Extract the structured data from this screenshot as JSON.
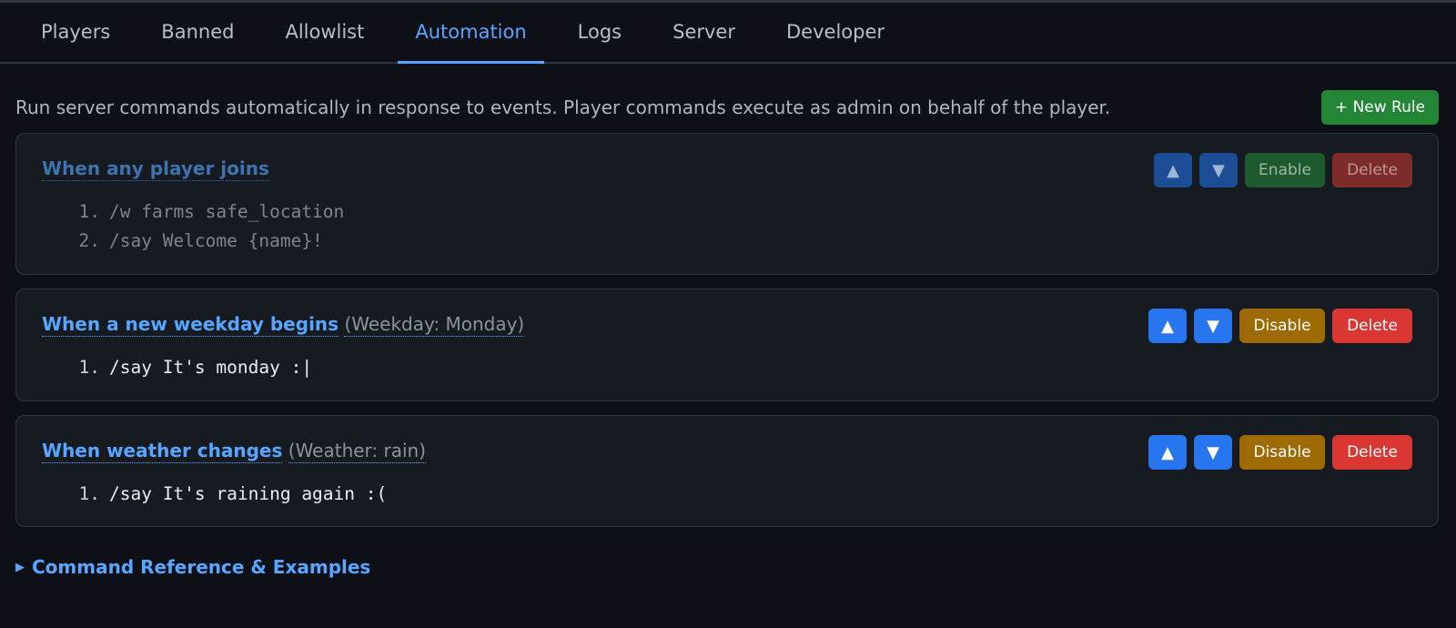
{
  "tabs": [
    {
      "label": "Players"
    },
    {
      "label": "Banned"
    },
    {
      "label": "Allowlist"
    },
    {
      "label": "Automation",
      "active": true
    },
    {
      "label": "Logs"
    },
    {
      "label": "Server"
    },
    {
      "label": "Developer"
    }
  ],
  "intro_text": "Run server commands automatically in response to events. Player commands execute as admin on behalf of the player.",
  "new_rule_label": "+ New Rule",
  "rules": [
    {
      "title": "When any player joins",
      "detail": "",
      "enabled": false,
      "commands": [
        {
          "num": "1.",
          "text": "/w farms safe_location"
        },
        {
          "num": "2.",
          "text": "/say Welcome {name}!"
        }
      ],
      "up_label": "▲",
      "down_label": "▼",
      "toggle_label": "Enable",
      "delete_label": "Delete"
    },
    {
      "title": "When a new weekday begins",
      "detail": "(Weekday: Monday)",
      "enabled": true,
      "commands": [
        {
          "num": "1.",
          "text": "/say It's monday :|"
        }
      ],
      "up_label": "▲",
      "down_label": "▼",
      "toggle_label": "Disable",
      "delete_label": "Delete"
    },
    {
      "title": "When weather changes",
      "detail": "(Weather: rain)",
      "enabled": true,
      "commands": [
        {
          "num": "1.",
          "text": "/say It's raining again :("
        }
      ],
      "up_label": "▲",
      "down_label": "▼",
      "toggle_label": "Disable",
      "delete_label": "Delete"
    }
  ],
  "reference": {
    "icon": "triangle-right-icon",
    "label": "Command Reference & Examples"
  },
  "colors": {
    "background": "#0d1117",
    "accent": "#58a6ff",
    "new_rule": "#238636",
    "disable": "#9e6a03",
    "delete": "#da3633"
  }
}
